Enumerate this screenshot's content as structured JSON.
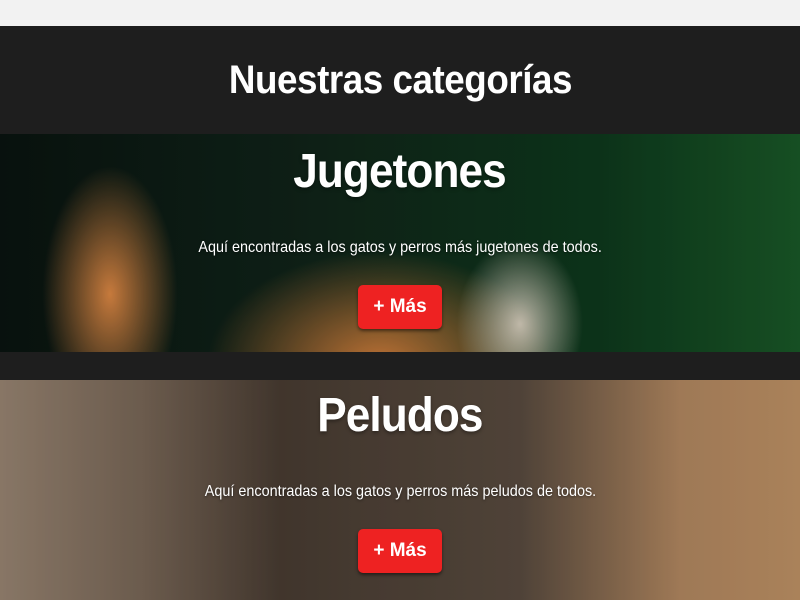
{
  "header": {
    "title": "Nuestras categorías"
  },
  "categories": [
    {
      "title": "Jugetones",
      "description": "Aquí encontradas a los gatos y perros más jugetones de todos.",
      "button_label": "+ Más"
    },
    {
      "title": "Peludos",
      "description": "Aquí encontradas a los gatos y perros más peludos de todos.",
      "button_label": "+ Más"
    }
  ],
  "colors": {
    "header_bg": "#1e1e1e",
    "button_bg": "#ee2222",
    "text": "#ffffff"
  }
}
